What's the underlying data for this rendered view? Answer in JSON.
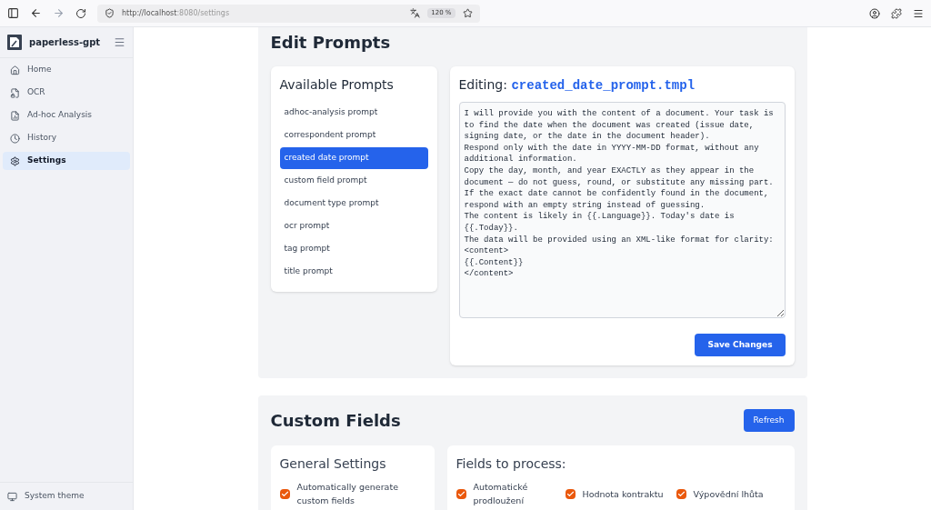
{
  "browser": {
    "url_host": "http://localhost",
    "url_rest": ":8080/settings",
    "zoom": "120 %"
  },
  "sidebar": {
    "app_name": "paperless-gpt",
    "items": [
      {
        "label": "Home",
        "selected": false
      },
      {
        "label": "OCR",
        "selected": false
      },
      {
        "label": "Ad-hoc Analysis",
        "selected": false
      },
      {
        "label": "History",
        "selected": false
      },
      {
        "label": "Settings",
        "selected": true
      }
    ],
    "theme": "System theme"
  },
  "edit_prompts": {
    "title": "Edit Prompts",
    "list_title": "Available Prompts",
    "prompts": [
      {
        "label": "adhoc-analysis prompt",
        "selected": false
      },
      {
        "label": "correspondent prompt",
        "selected": false
      },
      {
        "label": "created date prompt",
        "selected": true
      },
      {
        "label": "custom field prompt",
        "selected": false
      },
      {
        "label": "document type prompt",
        "selected": false
      },
      {
        "label": "ocr prompt",
        "selected": false
      },
      {
        "label": "tag prompt",
        "selected": false
      },
      {
        "label": "title prompt",
        "selected": false
      }
    ],
    "editing_label": "Editing:",
    "editing_file": "created_date_prompt.tmpl",
    "text": "I will provide you with the content of a document. Your task is to find the date when the document was created (issue date, signing date, or the date in the document header).\nRespond only with the date in YYYY-MM-DD format, without any additional information.\nCopy the day, month, and year EXACTLY as they appear in the document — do not guess, round, or substitute any missing part.\nIf the exact date cannot be confidently found in the document, respond with an empty string instead of guessing.\nThe content is likely in {{.Language}}. Today's date is {{.Today}}.\nThe data will be provided using an XML-like format for clarity:\n<content>\n{{.Content}}\n</content>",
    "save": "Save Changes"
  },
  "custom_fields": {
    "title": "Custom Fields",
    "refresh": "Refresh",
    "general_title": "General Settings",
    "general": [
      {
        "label": "Automatically generate custom fields",
        "checked": true
      }
    ],
    "fields_title": "Fields to process:",
    "fields": [
      {
        "label": "Automatické prodloužení",
        "checked": true
      },
      {
        "label": "Hodnota kontraktu",
        "checked": true
      },
      {
        "label": "Výpovědní lhůta",
        "checked": true
      }
    ]
  }
}
